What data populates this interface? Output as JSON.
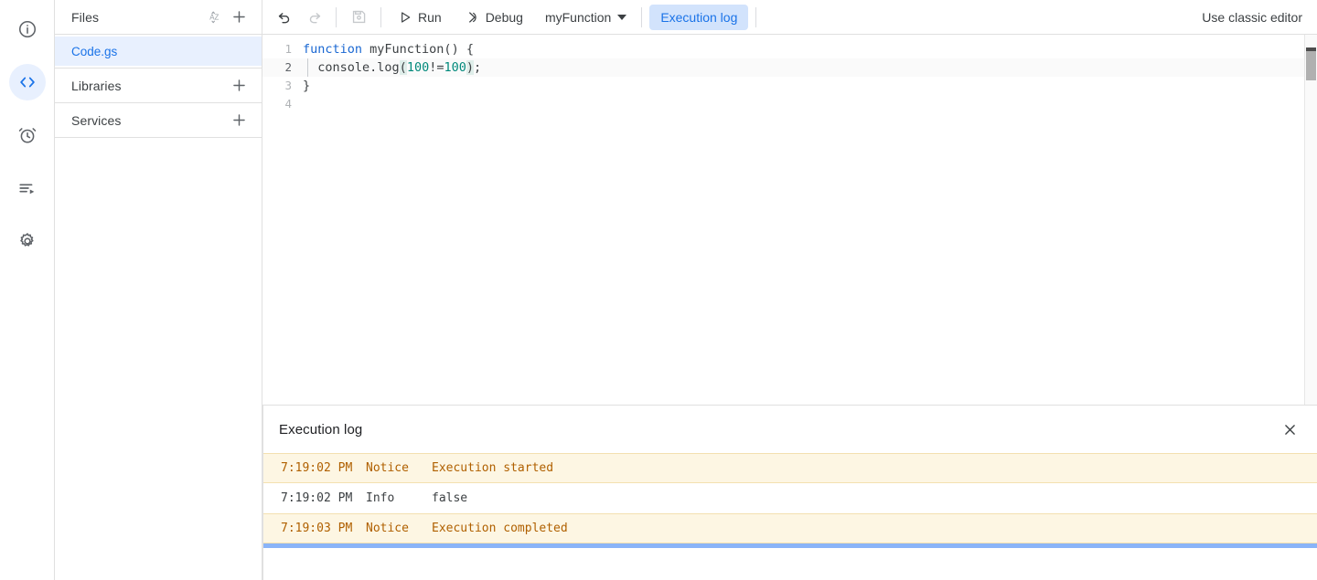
{
  "rail": {
    "items": [
      {
        "name": "overview",
        "icon": "info-icon",
        "active": false
      },
      {
        "name": "editor",
        "icon": "code-icon",
        "active": true
      },
      {
        "name": "triggers",
        "icon": "alarm-clock-icon",
        "active": false
      },
      {
        "name": "executions",
        "icon": "executions-list-icon",
        "active": false
      },
      {
        "name": "settings",
        "icon": "gear-icon",
        "active": false
      }
    ]
  },
  "sidebar": {
    "files_header": {
      "title": "Files",
      "sort_icon": "sort-az-icon",
      "add_icon": "plus-icon"
    },
    "files": [
      {
        "label": "Code.gs",
        "selected": true
      }
    ],
    "libraries_header": {
      "title": "Libraries",
      "add_icon": "plus-icon"
    },
    "services_header": {
      "title": "Services",
      "add_icon": "plus-icon"
    }
  },
  "toolbar": {
    "undo": {
      "label": "Undo",
      "icon": "undo-icon",
      "enabled": true
    },
    "redo": {
      "label": "Redo",
      "icon": "redo-icon",
      "enabled": false
    },
    "save": {
      "label": "Save project",
      "icon": "save-disk-icon",
      "enabled": false
    },
    "run_label": "Run",
    "debug_label": "Debug",
    "function_selected": "myFunction",
    "execution_log_label": "Execution log",
    "classic_editor_label": "Use classic editor"
  },
  "editor": {
    "lines": [
      {
        "number": "1",
        "active": false,
        "tokens": [
          {
            "text": "function",
            "kind": "kw"
          },
          {
            "text": " myFunction() {",
            "kind": "punc"
          }
        ]
      },
      {
        "number": "2",
        "active": true,
        "tokens": [
          {
            "text": "  console.log",
            "kind": "punc"
          },
          {
            "text": "(",
            "kind": "brk"
          },
          {
            "text": "100",
            "kind": "num"
          },
          {
            "text": "!=",
            "kind": "punc"
          },
          {
            "text": "100",
            "kind": "num"
          },
          {
            "text": ")",
            "kind": "brk"
          },
          {
            "text": ";",
            "kind": "punc"
          }
        ]
      },
      {
        "number": "3",
        "active": false,
        "tokens": [
          {
            "text": "}",
            "kind": "punc"
          }
        ]
      },
      {
        "number": "4",
        "active": false,
        "tokens": [
          {
            "text": "",
            "kind": "punc"
          }
        ]
      }
    ],
    "full_source": "function myFunction() {\n  console.log(100!=100);\n}\n"
  },
  "execution_log": {
    "title": "Execution log",
    "close_icon": "close-icon",
    "rows": [
      {
        "time": "7:19:02 PM",
        "level": "Notice",
        "message": "Execution started",
        "type": "notice"
      },
      {
        "time": "7:19:02 PM",
        "level": "Info",
        "message": "false",
        "type": "info"
      },
      {
        "time": "7:19:03 PM",
        "level": "Notice",
        "message": "Execution completed",
        "type": "notice"
      }
    ]
  },
  "colors": {
    "accent_blue": "#1a73e8",
    "selected_bg": "#e8f0fe",
    "pill_bg": "#d2e3fc",
    "notice_bg": "#fdf6e3",
    "notice_text": "#b06000",
    "progress_bar": "#8ab4f8",
    "keyword": "#1967d2",
    "number": "#00897b"
  }
}
